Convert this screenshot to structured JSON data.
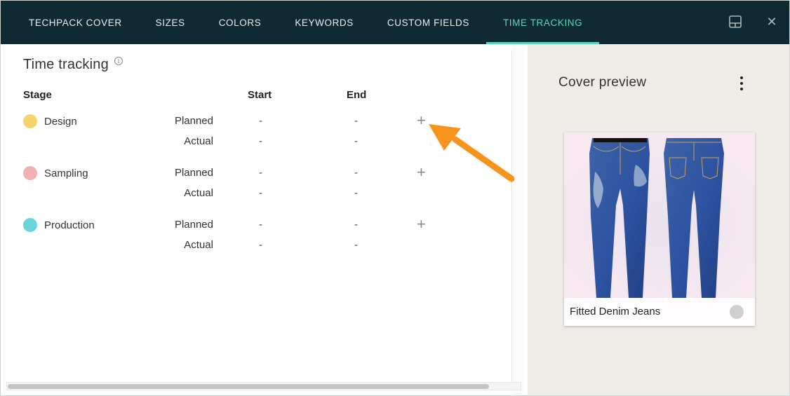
{
  "tabs": [
    {
      "label": "TECHPACK COVER",
      "active": false
    },
    {
      "label": "SIZES",
      "active": false
    },
    {
      "label": "COLORS",
      "active": false
    },
    {
      "label": "KEYWORDS",
      "active": false
    },
    {
      "label": "CUSTOM FIELDS",
      "active": false
    },
    {
      "label": "TIME TRACKING",
      "active": true
    }
  ],
  "header_icons": [
    "panel-layout-icon",
    "close-icon"
  ],
  "close_glyph": "✕",
  "time_tracking": {
    "title": "Time tracking",
    "info_glyph": "i",
    "columns": {
      "stage": "Stage",
      "start": "Start",
      "end": "End"
    },
    "stages": [
      {
        "name": "Design",
        "color": "#f6d36f",
        "rows": [
          {
            "label": "Planned",
            "start": "-",
            "end": "-"
          },
          {
            "label": "Actual",
            "start": "-",
            "end": "-"
          }
        ]
      },
      {
        "name": "Sampling",
        "color": "#f2b1b3",
        "rows": [
          {
            "label": "Planned",
            "start": "-",
            "end": "-"
          },
          {
            "label": "Actual",
            "start": "-",
            "end": "-"
          }
        ]
      },
      {
        "name": "Production",
        "color": "#6ad4db",
        "rows": [
          {
            "label": "Planned",
            "start": "-",
            "end": "-"
          },
          {
            "label": "Actual",
            "start": "-",
            "end": "-"
          }
        ]
      }
    ],
    "add_glyph": "+"
  },
  "cover_preview": {
    "title": "Cover preview",
    "product_name": "Fitted Denim Jeans"
  },
  "colors": {
    "header_bg": "#0f2a33",
    "accent": "#58d6c0",
    "arrow": "#f7941d",
    "right_panel_bg": "#efebe6"
  }
}
